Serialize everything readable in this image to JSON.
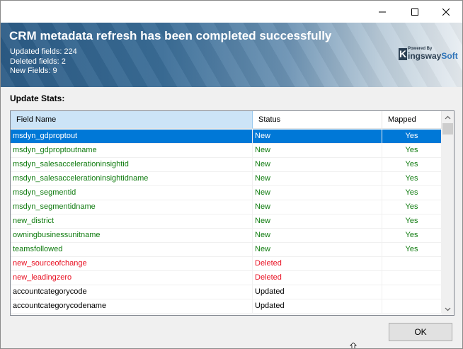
{
  "window": {
    "controls": {
      "minimize": "minimize-icon",
      "maximize": "maximize-icon",
      "close": "close-icon"
    }
  },
  "banner": {
    "title": "CRM metadata refresh has been completed successfully",
    "stats": {
      "updated": "Updated fields: 224",
      "deleted": "Deleted fields: 2",
      "new": "New Fields: 9"
    },
    "logo": {
      "powered": "Powered By",
      "k": "K",
      "word_a": "ingsway",
      "word_b": "Soft"
    }
  },
  "section_label": "Update Stats:",
  "grid": {
    "columns": [
      "Field Name",
      "Status",
      "Mapped"
    ],
    "rows": [
      {
        "field": "msdyn_gdproptout",
        "status": "New",
        "mapped": "Yes",
        "color": "#107c10",
        "selected": true
      },
      {
        "field": "msdyn_gdproptoutname",
        "status": "New",
        "mapped": "Yes",
        "color": "#107c10"
      },
      {
        "field": "msdyn_salesaccelerationinsightid",
        "status": "New",
        "mapped": "Yes",
        "color": "#107c10"
      },
      {
        "field": "msdyn_salesaccelerationinsightidname",
        "status": "New",
        "mapped": "Yes",
        "color": "#107c10"
      },
      {
        "field": "msdyn_segmentid",
        "status": "New",
        "mapped": "Yes",
        "color": "#107c10"
      },
      {
        "field": "msdyn_segmentidname",
        "status": "New",
        "mapped": "Yes",
        "color": "#107c10"
      },
      {
        "field": "new_district",
        "status": "New",
        "mapped": "Yes",
        "color": "#107c10"
      },
      {
        "field": "owningbusinessunitname",
        "status": "New",
        "mapped": "Yes",
        "color": "#107c10"
      },
      {
        "field": "teamsfollowed",
        "status": "New",
        "mapped": "Yes",
        "color": "#107c10"
      },
      {
        "field": "new_sourceofchange",
        "status": "Deleted",
        "mapped": "",
        "color": "#e81123"
      },
      {
        "field": "new_leadingzero",
        "status": "Deleted",
        "mapped": "",
        "color": "#e81123"
      },
      {
        "field": "accountcategorycode",
        "status": "Updated",
        "mapped": "",
        "color": "#000000"
      },
      {
        "field": "accountcategorycodename",
        "status": "Updated",
        "mapped": "",
        "color": "#000000"
      }
    ]
  },
  "buttons": {
    "ok": "OK"
  }
}
